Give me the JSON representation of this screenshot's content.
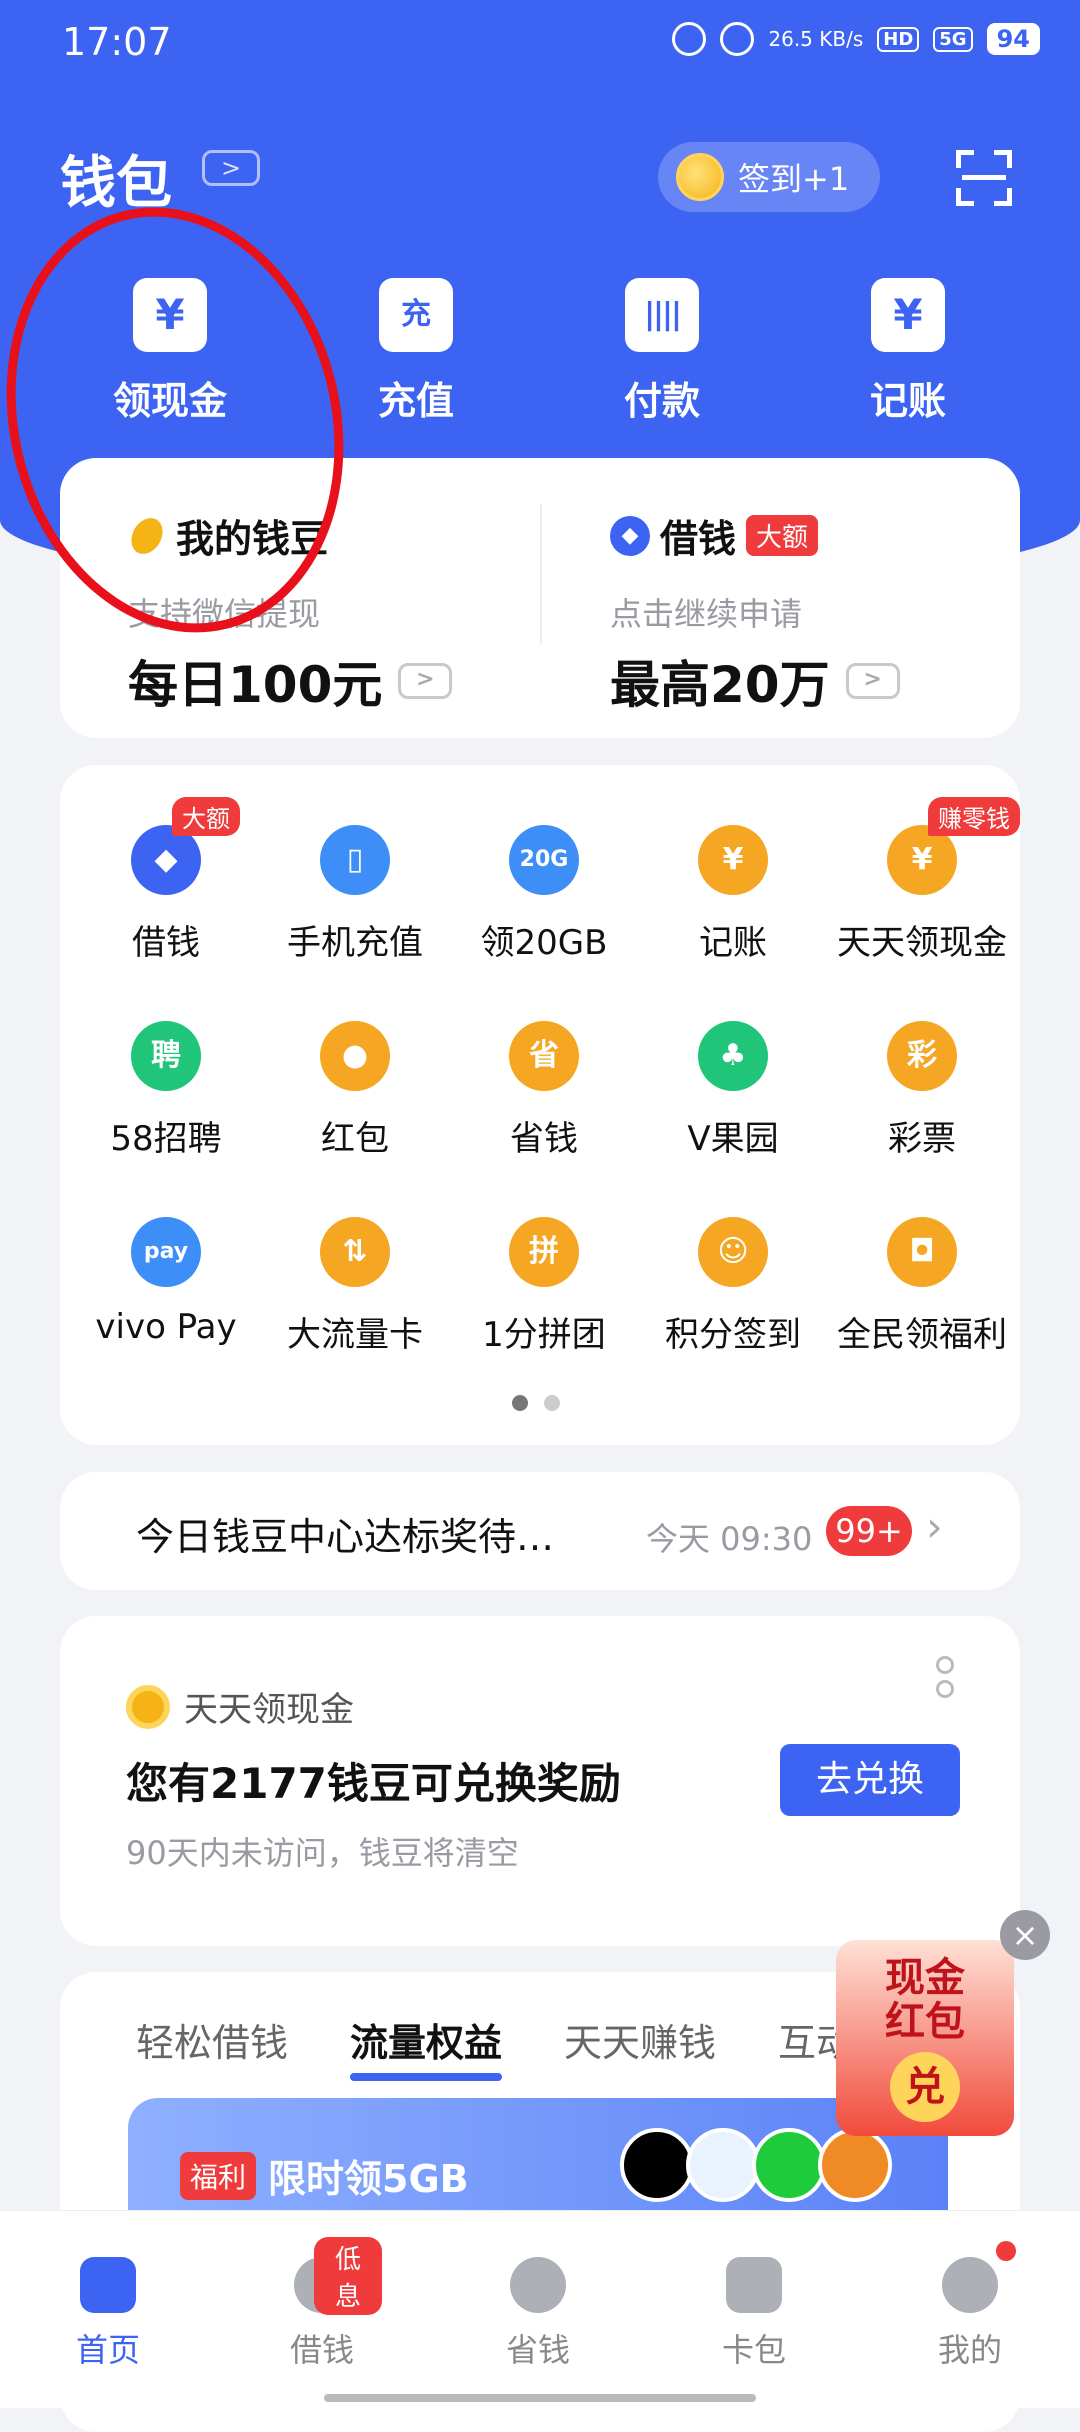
{
  "status": {
    "time": "17:07",
    "net_speed": "26.5 KB/s",
    "hd": "HD",
    "signal": "5G",
    "battery": "94"
  },
  "header": {
    "title": "钱包",
    "signin": "签到+1"
  },
  "quick": [
    {
      "label": "领现金",
      "glyph": "¥"
    },
    {
      "label": "充值",
      "glyph": "充"
    },
    {
      "label": "付款",
      "glyph": "||||"
    },
    {
      "label": "记账",
      "glyph": "¥"
    }
  ],
  "card_beans": {
    "title": "我的钱豆",
    "sub": "支持微信提现",
    "big": "每日100元",
    "arrow": ">"
  },
  "card_loan": {
    "title": "借钱",
    "tag": "大额",
    "sub": "点击继续申请",
    "big": "最高20万",
    "arrow": ">"
  },
  "grid": [
    {
      "label": "借钱",
      "glyph": "◆",
      "color": "#3d63f2",
      "badge": "大额"
    },
    {
      "label": "手机充值",
      "glyph": "▯",
      "color": "#3d8ef7"
    },
    {
      "label": "领20GB",
      "glyph": "20G",
      "color": "#3d8ef7"
    },
    {
      "label": "记账",
      "glyph": "¥",
      "color": "#f5a623"
    },
    {
      "label": "天天领现金",
      "glyph": "¥",
      "color": "#f5a623",
      "badge": "赚零钱"
    },
    {
      "label": "58招聘",
      "glyph": "聘",
      "color": "#20c57a"
    },
    {
      "label": "红包",
      "glyph": "●",
      "color": "#f5a623"
    },
    {
      "label": "省钱",
      "glyph": "省",
      "color": "#f5a623"
    },
    {
      "label": "V果园",
      "glyph": "♣",
      "color": "#20c57a"
    },
    {
      "label": "彩票",
      "glyph": "彩",
      "color": "#f5a623"
    },
    {
      "label": "vivo Pay",
      "glyph": "pay",
      "color": "#3d8ef7"
    },
    {
      "label": "大流量卡",
      "glyph": "⇅",
      "color": "#f5a623"
    },
    {
      "label": "1分拼团",
      "glyph": "拼",
      "color": "#f5a623"
    },
    {
      "label": "积分签到",
      "glyph": "☺",
      "color": "#f5a623"
    },
    {
      "label": "全民领福利",
      "glyph": "◘",
      "color": "#f5a623"
    }
  ],
  "notice": {
    "text": "今日钱豆中心达标奖待…",
    "time": "今天 09:30",
    "count": "99+",
    "chevron": "›"
  },
  "promo": {
    "header": "天天领现金",
    "main": "您有2177钱豆可兑换奖励",
    "note": "90天内未访问，钱豆将清空",
    "button": "去兑换"
  },
  "tabs": [
    "轻松借钱",
    "流量权益",
    "天天赚钱",
    "互动"
  ],
  "banner": {
    "tag": "福利",
    "text": "限时领5GB"
  },
  "float_ad": {
    "line1": "现金",
    "line2": "红包",
    "center": "兑",
    "close": "×"
  },
  "nav": [
    {
      "label": "首页",
      "active": true
    },
    {
      "label": "借钱",
      "tag": "低息"
    },
    {
      "label": "省钱"
    },
    {
      "label": "卡包"
    },
    {
      "label": "我的",
      "dot": true
    }
  ]
}
